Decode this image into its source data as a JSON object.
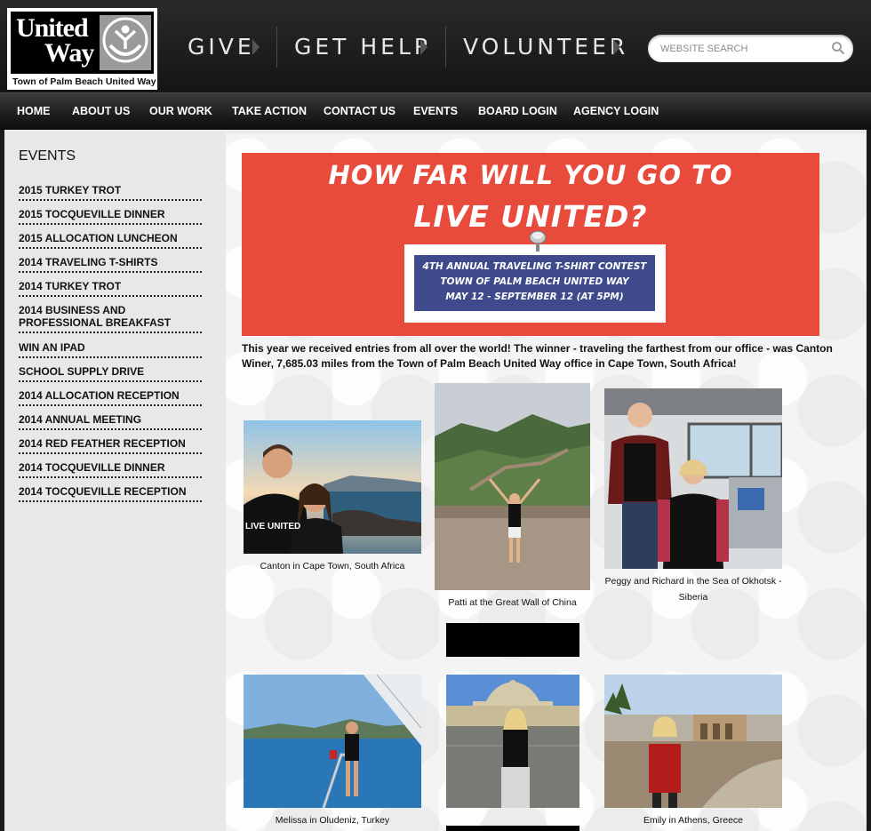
{
  "logo": {
    "line1": "United",
    "line2": "Way",
    "tagline": "Town of Palm Beach United Way"
  },
  "topnav": {
    "give": "GIVE",
    "get_help": "GET HELP",
    "volunteer": "VOLUNTEER"
  },
  "search": {
    "placeholder": "WEBSITE SEARCH"
  },
  "mainnav": [
    "HOME",
    "ABOUT US",
    "OUR WORK",
    "TAKE ACTION",
    "CONTACT US",
    "EVENTS",
    "BOARD LOGIN",
    "AGENCY LOGIN"
  ],
  "sidebar": {
    "title": "EVENTS",
    "items": [
      "2015 TURKEY TROT",
      "2015 TOCQUEVILLE DINNER",
      "2015 ALLOCATION LUNCHEON",
      "2014 TRAVELING T-SHIRTS",
      "2014 TURKEY TROT",
      "2014 BUSINESS AND PROFESSIONAL BREAKFAST",
      "WIN AN IPAD",
      "SCHOOL SUPPLY DRIVE",
      "2014 ALLOCATION RECEPTION",
      "2014 ANNUAL MEETING",
      "2014 RED FEATHER RECEPTION",
      "2014 TOCQUEVILLE DINNER",
      "2014 TOCQUEVILLE RECEPTION"
    ]
  },
  "banner": {
    "line1": "HOW FAR WILL YOU GO TO",
    "line2": "LIVE UNITED?",
    "box_line1": "4TH ANNUAL TRAVELING T-SHIRT CONTEST",
    "box_line2": "TOWN OF PALM BEACH UNITED WAY",
    "box_line3": "MAY 12 - SEPTEMBER 12 (AT 5PM)"
  },
  "intro": "This year we received entries from all over the world! The winner - traveling the farthest from our office - was Canton Winer, 7,685.03 miles from the Town of Palm Beach United Way office in Cape Town, South Africa!",
  "photos": {
    "cape_town": "Canton in Cape Town, South Africa",
    "great_wall": "Patti at the Great Wall of China",
    "okhotsk": "Peggy and Richard in the Sea of Okhotsk - Siberia",
    "oludeniz": "Melissa in Oludeniz, Turkey",
    "athens": "Emily in Athens, Greece",
    "shirt_text": "LIVE UNITED"
  },
  "colors": {
    "banner_red": "#e84b3c",
    "banner_blue": "#3e4a8c",
    "header_dark": "#1d1d1d"
  }
}
